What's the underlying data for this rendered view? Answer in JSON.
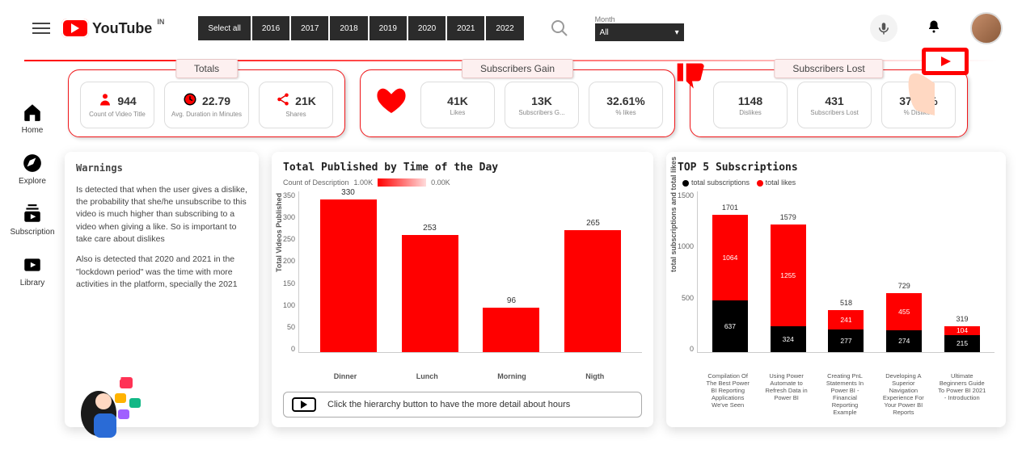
{
  "header": {
    "brand": "YouTube",
    "region": "IN",
    "years_select_all": "Select all",
    "years": [
      "2016",
      "2017",
      "2018",
      "2019",
      "2020",
      "2021",
      "2022"
    ],
    "month_label": "Month",
    "month_value": "All"
  },
  "rail": {
    "home": "Home",
    "explore": "Explore",
    "subscription": "Subscription",
    "library": "Library"
  },
  "totals": {
    "title": "Totals",
    "count_value": "944",
    "count_label": "Count of Video Title",
    "dur_value": "22.79",
    "dur_label": "Avg. Duration in Minutes",
    "shares_value": "21K",
    "shares_label": "Shares"
  },
  "gain": {
    "title": "Subscribers Gain",
    "likes_value": "41K",
    "likes_label": "Likes",
    "subs_value": "13K",
    "subs_label": "Subscribers G...",
    "pct_value": "32.61%",
    "pct_label": "% likes"
  },
  "lost": {
    "title": "Subscribers Lost",
    "dislikes_value": "1148",
    "dislikes_label": "Dislikes",
    "subs_value": "431",
    "subs_label": "Subscribers Lost",
    "pct_value": "37.54%",
    "pct_label": "% Dislikes"
  },
  "warnings": {
    "title": "Warnings",
    "p1": "Is detected that when the user gives a dislike, the probability that she/he unsubscribe to this video is much higher than subscribing to a video when giving a like. So is important to take care about dislikes",
    "p2": "Also is detected that 2020 and 2021 in the \"lockdown period\" was the time with more activities in the platform, specially the 2021"
  },
  "timechart": {
    "title": "Total Published by Time of the Day",
    "legend_measure": "Count of Description",
    "legend_max": "1.00K",
    "legend_min": "0.00K",
    "ylabel": "Total Videos Published",
    "foot": "Click the hierarchy button to  have the more  detail about hours"
  },
  "topchart": {
    "title": "TOP 5 Subscriptions",
    "legend_subs": "total subscriptions",
    "legend_likes": "total likes",
    "ylabel": "total subscriptions and total likes"
  },
  "chart_data": [
    {
      "type": "bar",
      "name": "Total Published by Time of the Day",
      "ylabel": "Total Videos Published",
      "categories": [
        "Dinner",
        "Lunch",
        "Morning",
        "Nigth"
      ],
      "values": [
        330,
        253,
        96,
        265
      ],
      "ylim": [
        0,
        350
      ],
      "yticks": [
        0,
        50,
        100,
        150,
        200,
        250,
        300,
        350
      ]
    },
    {
      "type": "bar",
      "name": "TOP 5 Subscriptions",
      "stacked": true,
      "ylabel": "total subscriptions and total likes",
      "categories": [
        "Compilation Of The Best Power BI Reporting Applications We've Seen",
        "Using Power Automate to Refresh Data in Power BI",
        "Creating PnL Statements In Power BI - Financial Reporting Example",
        "Developing A Superior Navigation Experience For Your Power BI Reports",
        "Ultimate Beginners Guide To Power BI 2021 - Introduction"
      ],
      "series": [
        {
          "name": "total subscriptions",
          "color": "#000000",
          "values": [
            637,
            324,
            277,
            274,
            215
          ]
        },
        {
          "name": "total likes",
          "color": "#ff0000",
          "values": [
            1064,
            1255,
            241,
            455,
            104
          ]
        }
      ],
      "totals": [
        1701,
        1579,
        518,
        729,
        319
      ],
      "ylim": [
        0,
        2000
      ],
      "yticks": [
        0,
        500,
        1000,
        1500
      ]
    }
  ]
}
